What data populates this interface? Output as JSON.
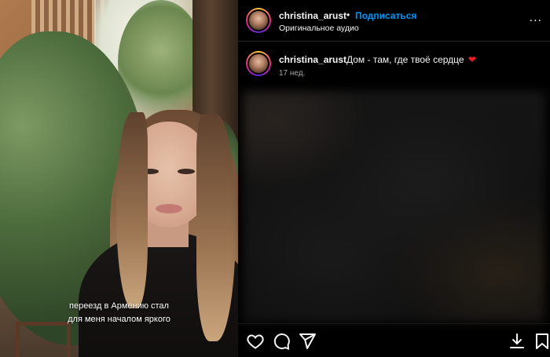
{
  "video": {
    "caption_line1": "переезд в Армению стал",
    "caption_line2": "для меня началом яркого"
  },
  "header": {
    "username": "christina_arust",
    "separator": "•",
    "follow_label": "Подписаться",
    "audio_label": "Оригинальное аудио",
    "more_label": "..."
  },
  "post": {
    "username": "christina_arust",
    "text": "Дом - там, где твоё сердце",
    "emoji": "❤",
    "time": "17 нед."
  },
  "icons": [
    "heart-icon",
    "comment-icon",
    "share-icon",
    "download-icon",
    "bookmark-icon"
  ],
  "colors": {
    "follow": "#0095f6",
    "heart_emoji": "#ed1c24",
    "secondary_text": "#a8a8a8"
  }
}
